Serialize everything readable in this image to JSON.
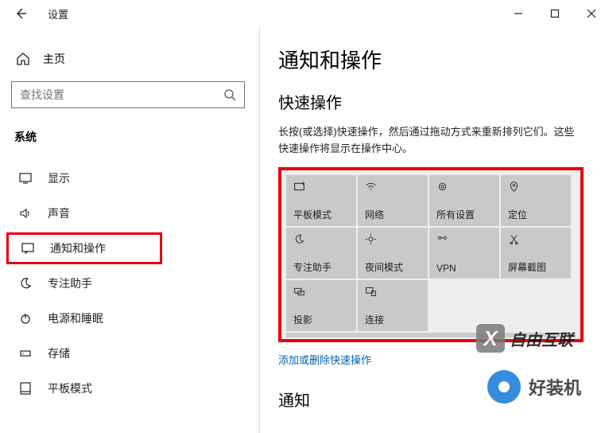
{
  "window": {
    "title": "设置"
  },
  "sidebar": {
    "home": "主页",
    "search_placeholder": "查找设置",
    "section": "系统",
    "items": [
      {
        "label": "显示"
      },
      {
        "label": "声音"
      },
      {
        "label": "通知和操作"
      },
      {
        "label": "专注助手"
      },
      {
        "label": "电源和睡眠"
      },
      {
        "label": "存储"
      },
      {
        "label": "平板模式"
      }
    ]
  },
  "content": {
    "page_title": "通知和操作",
    "quick_section": "快速操作",
    "quick_desc": "长按(或选择)快速操作，然后通过拖动方式来重新排列它们。这些快速操作将显示在操作中心。",
    "tiles": [
      {
        "label": "平板模式"
      },
      {
        "label": "网络"
      },
      {
        "label": "所有设置"
      },
      {
        "label": "定位"
      },
      {
        "label": "专注助手"
      },
      {
        "label": "夜间模式"
      },
      {
        "label": "VPN"
      },
      {
        "label": "屏幕截图"
      },
      {
        "label": "投影"
      },
      {
        "label": "连接"
      }
    ],
    "link_text": "添加或删除快速操作",
    "notify_section": "通知"
  },
  "watermark1": "自由互联",
  "watermark2": "好装机"
}
